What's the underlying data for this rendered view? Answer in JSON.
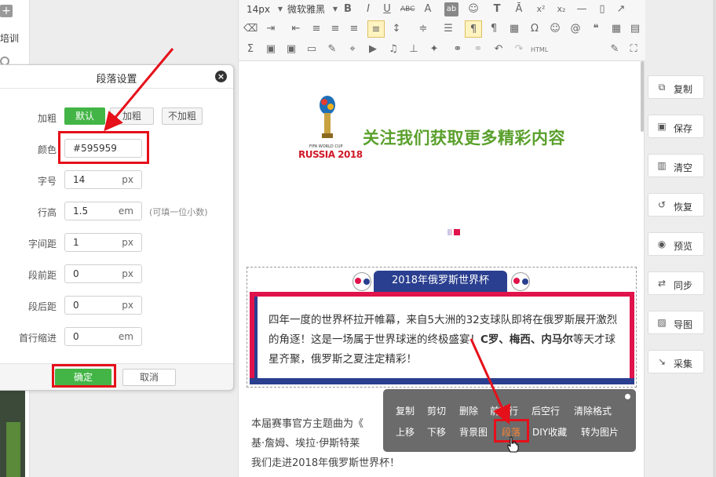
{
  "left": {
    "partial_text": "培训"
  },
  "dialog": {
    "title": "段落设置",
    "bold": {
      "label": "加粗",
      "options": [
        "默认",
        "加粗",
        "不加粗"
      ],
      "selected": "默认"
    },
    "color": {
      "label": "颜色",
      "value": "#595959"
    },
    "font_size": {
      "label": "字号",
      "value": "14",
      "unit": "px"
    },
    "line_height": {
      "label": "行高",
      "value": "1.5",
      "unit": "em",
      "hint": "(可填一位小数)"
    },
    "letter_spacing": {
      "label": "字间距",
      "value": "1",
      "unit": "px"
    },
    "space_before": {
      "label": "段前距",
      "value": "0",
      "unit": "px"
    },
    "space_after": {
      "label": "段后距",
      "value": "0",
      "unit": "px"
    },
    "indent": {
      "label": "首行缩进",
      "value": "0",
      "unit": "em"
    },
    "ok_label": "确定",
    "cancel_label": "取消"
  },
  "toolbar": {
    "font_size": "14px",
    "font_family": "微软雅黑",
    "html_label": "HTML"
  },
  "content": {
    "banner_title": "关注我们获取更多精彩内容",
    "logo_text": "RUSSIA 2018",
    "logo_small": "FIFA WORLD CUP",
    "tab_title": "2018年俄罗斯世界杯",
    "para_part1": "四年一度的世界杯拉开帷幕，来自5大洲的32支球队即将在俄罗斯展开激烈的角逐！这是一场属于世界球迷的终极盛宴！",
    "para_bold1": "C罗、梅西、内马尔",
    "para_part2": "等天才球星齐聚，俄罗斯之夏注定精彩！",
    "body_line1": "本届赛事官方主题曲为《",
    "body_line2": "基·詹姆、埃拉·伊斯特莱",
    "body_line3": "我们走进2018年俄罗斯世界杯！"
  },
  "context_menu": {
    "row1": [
      "复制",
      "剪切",
      "删除",
      "前空行",
      "后空行",
      "清除格式"
    ],
    "row2": [
      "上移",
      "下移",
      "背景图",
      "段落",
      "DIY收藏",
      "转为图片"
    ],
    "highlighted": "段落"
  },
  "side_buttons": [
    {
      "label": "复制",
      "icon": "copy-icon"
    },
    {
      "label": "保存",
      "icon": "save-icon"
    },
    {
      "label": "清空",
      "icon": "trash-icon"
    },
    {
      "label": "恢复",
      "icon": "restore-icon"
    },
    {
      "label": "预览",
      "icon": "eye-icon"
    },
    {
      "label": "同步",
      "icon": "sync-icon"
    },
    {
      "label": "导图",
      "icon": "image-export-icon"
    },
    {
      "label": "采集",
      "icon": "collect-icon"
    }
  ],
  "colors": {
    "accent_green": "#43b546",
    "annotation_red": "#e5101a",
    "frame_blue": "#2a3f8f",
    "frame_red": "#e0134b",
    "banner_green": "#5aa02c"
  }
}
